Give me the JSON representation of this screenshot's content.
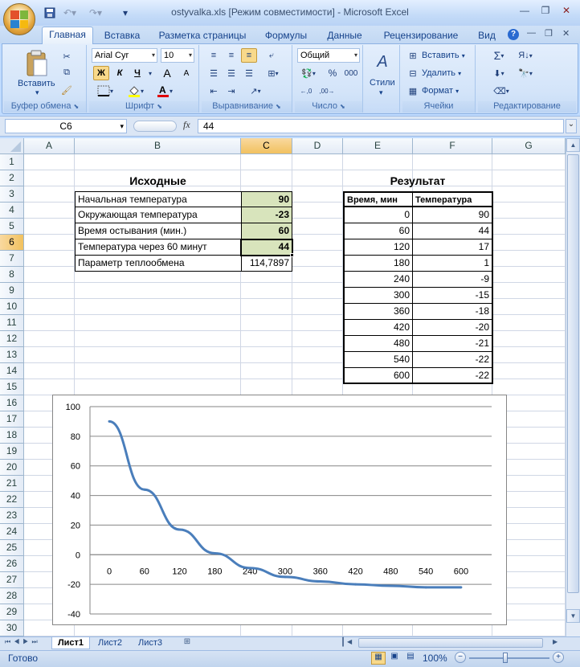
{
  "window": {
    "title": "ostyvalka.xls  [Режим совместимости] - Microsoft Excel"
  },
  "quick_access": {
    "save_icon": "save-icon",
    "undo_icon": "undo-icon",
    "redo_icon": "redo-icon",
    "customize": "▾"
  },
  "ribbon": {
    "tabs": [
      "Главная",
      "Вставка",
      "Разметка страницы",
      "Формулы",
      "Данные",
      "Рецензирование",
      "Вид"
    ],
    "active_tab": "Главная",
    "clipboard": {
      "paste": "Вставить",
      "label": "Буфер обмена"
    },
    "font": {
      "name": "Arial Cyr",
      "size": "10",
      "bold": "Ж",
      "italic": "К",
      "underline": "Ч",
      "grow": "A",
      "shrink": "A",
      "label": "Шрифт"
    },
    "alignment": {
      "label": "Выравнивание"
    },
    "number": {
      "format": "Общий",
      "percent": "%",
      "thousands": "000",
      "label": "Число"
    },
    "styles": {
      "label": "Стили"
    },
    "cells": {
      "insert": "Вставить",
      "delete": "Удалить",
      "format": "Формат",
      "label": "Ячейки"
    },
    "editing": {
      "label": "Редактирование"
    }
  },
  "formula_bar": {
    "name_box": "C6",
    "fx": "fx",
    "value": "44"
  },
  "columns": [
    "A",
    "B",
    "C",
    "D",
    "E",
    "F",
    "G"
  ],
  "rows": [
    "1",
    "2",
    "3",
    "4",
    "5",
    "6",
    "7",
    "8",
    "9",
    "10",
    "11",
    "12",
    "13",
    "14",
    "15",
    "16",
    "17",
    "18",
    "19",
    "20",
    "21",
    "22",
    "23",
    "24",
    "25",
    "26",
    "27",
    "28",
    "29",
    "30"
  ],
  "inputs": {
    "header": "Исходные",
    "rows": [
      {
        "label": "Начальная температура",
        "value": "90"
      },
      {
        "label": "Окружающая температура",
        "value": "-23"
      },
      {
        "label": "Время остывания (мин.)",
        "value": "60"
      },
      {
        "label": "Температура через 60 минут",
        "value": "44"
      },
      {
        "label": "Параметр теплообмена",
        "value": "114,7897"
      }
    ]
  },
  "results": {
    "header": "Результат",
    "col_time": "Время, мин",
    "col_temp": "Температура",
    "rows": [
      {
        "time": "0",
        "temp": "90"
      },
      {
        "time": "60",
        "temp": "44"
      },
      {
        "time": "120",
        "temp": "17"
      },
      {
        "time": "180",
        "temp": "1"
      },
      {
        "time": "240",
        "temp": "-9"
      },
      {
        "time": "300",
        "temp": "-15"
      },
      {
        "time": "360",
        "temp": "-18"
      },
      {
        "time": "420",
        "temp": "-20"
      },
      {
        "time": "480",
        "temp": "-21"
      },
      {
        "time": "540",
        "temp": "-22"
      },
      {
        "time": "600",
        "temp": "-22"
      }
    ]
  },
  "chart_data": {
    "type": "line",
    "categories": [
      "0",
      "60",
      "120",
      "180",
      "240",
      "300",
      "360",
      "420",
      "480",
      "540",
      "600"
    ],
    "series": [
      {
        "values": [
          90,
          44,
          17,
          1,
          -9,
          -15,
          -18,
          -20,
          -21,
          -22,
          -22
        ],
        "color": "#4a7ebb"
      }
    ],
    "ylim": [
      -40,
      100
    ],
    "yticks": [
      "100",
      "80",
      "60",
      "40",
      "20",
      "0",
      "-20",
      "-40"
    ],
    "grid": true,
    "legend": "none"
  },
  "sheet_tabs": [
    "Лист1",
    "Лист2",
    "Лист3"
  ],
  "active_sheet": "Лист1",
  "status": {
    "ready": "Готово",
    "zoom": "100%"
  },
  "colors": {
    "selected_header": "#f1c15f",
    "input_fill": "#d8e4bc",
    "line": "#4a7ebb"
  }
}
